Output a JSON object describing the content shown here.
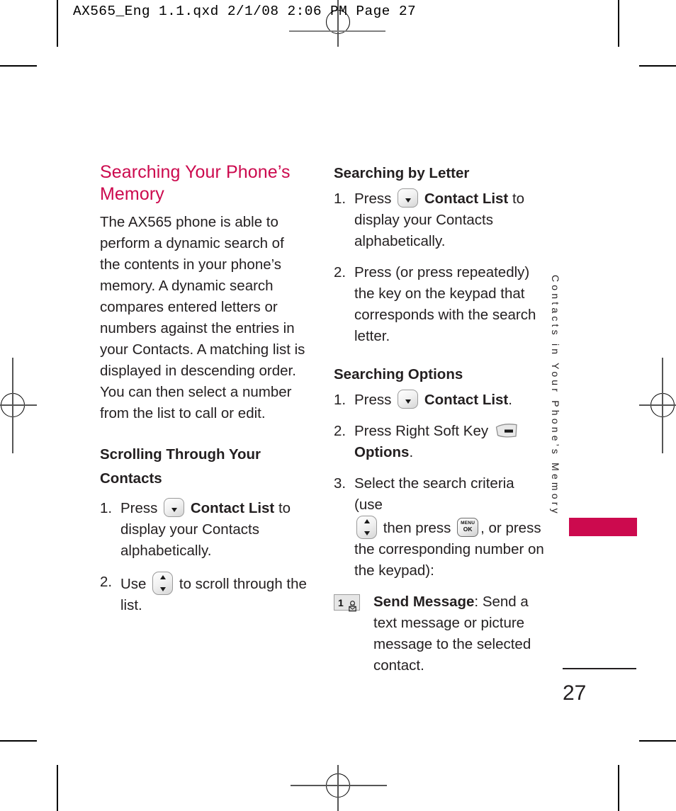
{
  "slug": {
    "text": "AX565_Eng 1.1.qxd  2/1/08  2:06 PM  Page 27"
  },
  "left_column": {
    "chapter_title": "Searching Your Phone’s Memory",
    "intro_paragraph": "The AX565 phone is able to perform a dynamic search of the contents in your phone’s memory. A dynamic search compares entered letters or numbers against the entries in your Contacts. A matching list is displayed in descending order. You can then select a number from the list to call or edit.",
    "section_heading": "Scrolling Through Your Contacts",
    "steps": [
      {
        "number": "1.",
        "pre": "Press",
        "icon": "contact-list-key-icon",
        "bold": "Contact List",
        "post": "to display your Contacts alphabetically."
      },
      {
        "number": "2.",
        "pre": "Use",
        "icon": "up-down-navigation-key-icon",
        "bold": "",
        "post": "to scroll through the list."
      }
    ]
  },
  "right_column": {
    "section_heading_1": "Searching by Letter",
    "steps_1": [
      {
        "number": "1.",
        "pre": "Press",
        "icon": "contact-list-key-icon",
        "bold": "Contact List",
        "post": "to display your Contacts alphabetically."
      },
      {
        "number": "2.",
        "pre": "Press (or press repeatedly) the key on the keypad that corresponds with the search letter.",
        "icon": "",
        "bold": "",
        "post": ""
      }
    ],
    "section_heading_2": "Searching Options",
    "steps_2": [
      {
        "number": "1.",
        "pre": "Press",
        "icon": "contact-list-key-icon",
        "bold": "Contact List",
        "post": "."
      },
      {
        "number": "2.",
        "pre": "Press Right Soft Key",
        "icon": "right-soft-key-icon",
        "bold": "Options",
        "post": "."
      },
      {
        "number": "3.",
        "pre": "Select the search criteria (use",
        "icon": "up-down-navigation-key-icon",
        "mid": "then press",
        "icon2": "menu-ok-key-icon",
        "post": ", or press the corresponding number on the keypad):"
      }
    ],
    "definition": {
      "icon": "key-1-send-message-icon",
      "icon_number": "1",
      "term": "Send Message",
      "description": ": Send a text message or picture message to the selected contact."
    }
  },
  "side_tab": {
    "label": "Contacts in Your Phone’s Memory"
  },
  "folio": {
    "page_number": "27"
  },
  "colors": {
    "accent": "#cc0a4e",
    "text": "#231f20"
  }
}
